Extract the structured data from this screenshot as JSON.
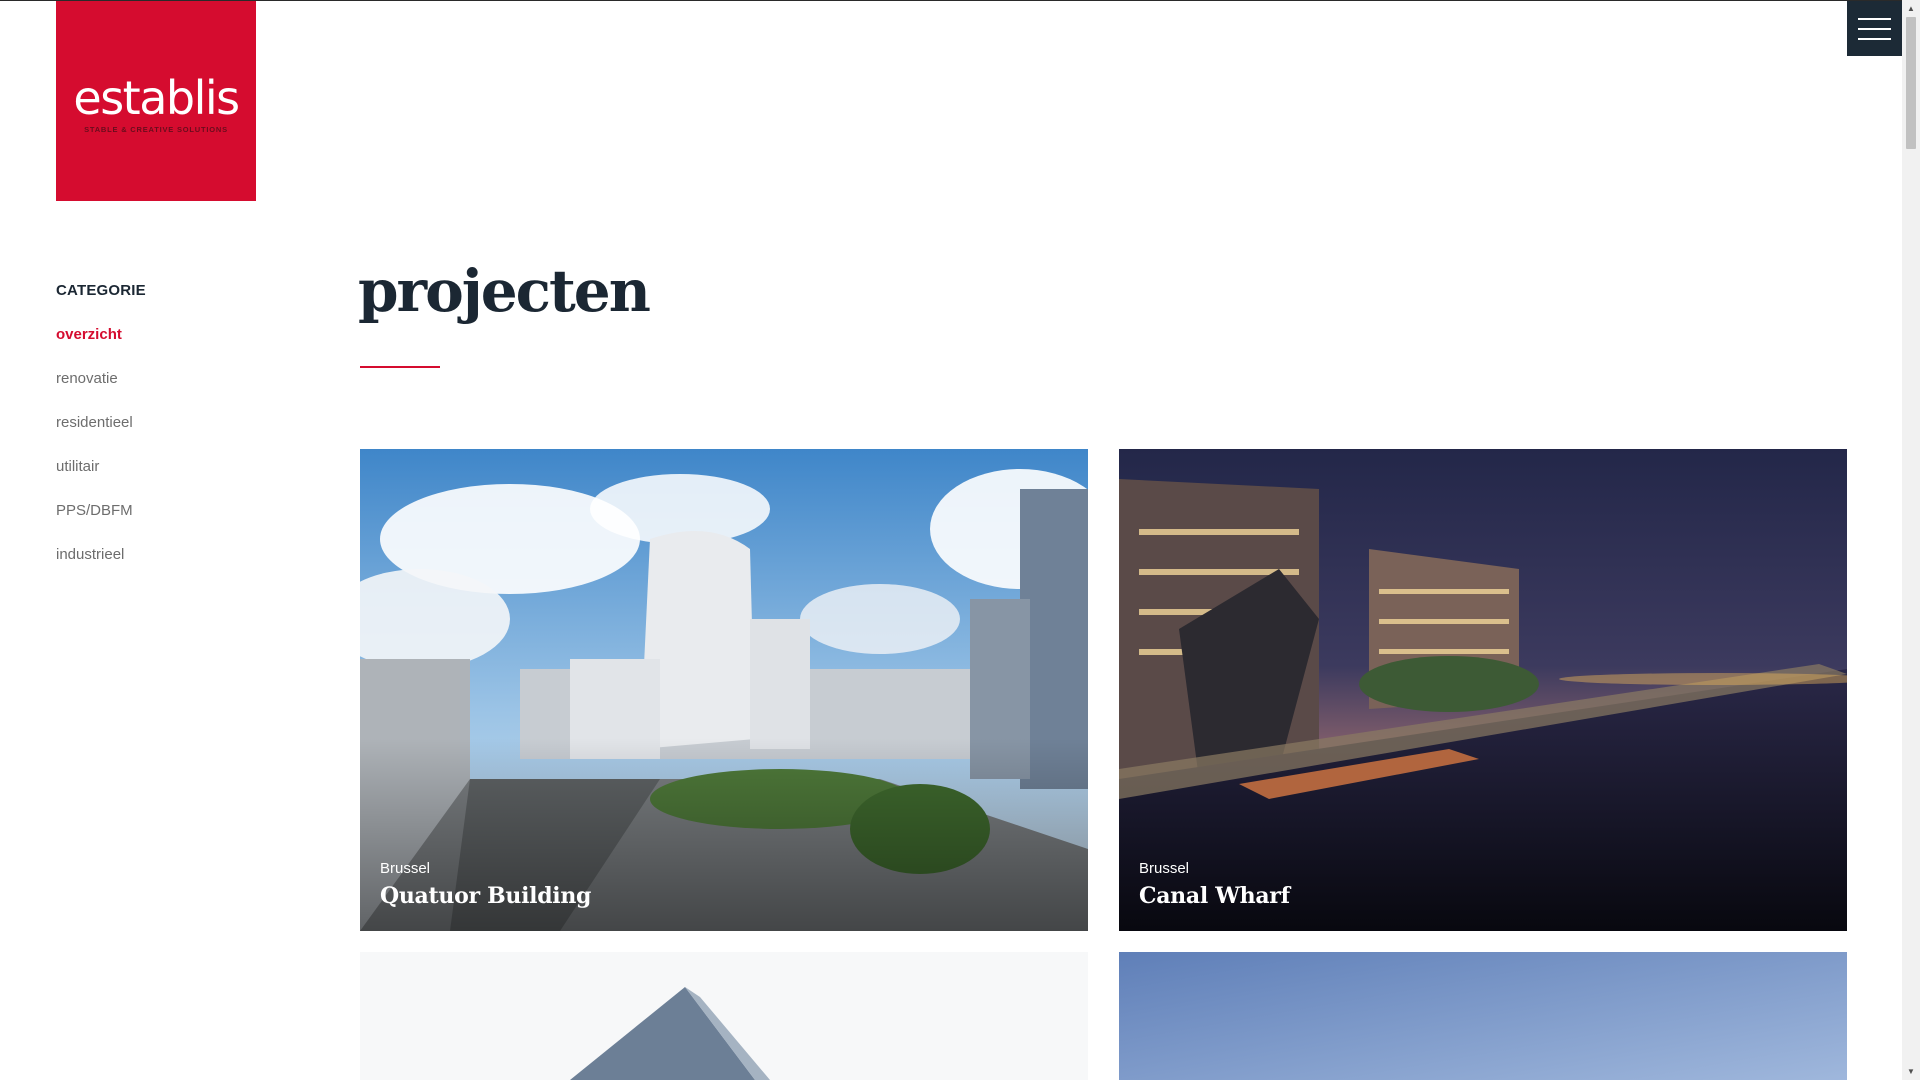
{
  "logo": {
    "wordmark": "establis",
    "tagline": "STABLE & CREATIVE SOLUTIONS",
    "color": "#d50c2f"
  },
  "menu": {
    "icon": "hamburger-menu-icon"
  },
  "sidebar": {
    "title": "CATEGORIE",
    "items": [
      {
        "label": "overzicht",
        "active": true
      },
      {
        "label": "renovatie",
        "active": false
      },
      {
        "label": "residentieel",
        "active": false
      },
      {
        "label": "utilitair",
        "active": false
      },
      {
        "label": "PPS/DBFM",
        "active": false
      },
      {
        "label": "industrieel",
        "active": false
      }
    ]
  },
  "page": {
    "title": "projecten"
  },
  "projects": [
    {
      "city": "Brussel",
      "name": "Quatuor Building"
    },
    {
      "city": "Brussel",
      "name": "Canal Wharf"
    },
    {
      "city": "",
      "name": ""
    },
    {
      "city": "",
      "name": ""
    }
  ],
  "colors": {
    "accent": "#d50c2f",
    "dark": "#1b2733",
    "muted": "#6d6d6d"
  }
}
